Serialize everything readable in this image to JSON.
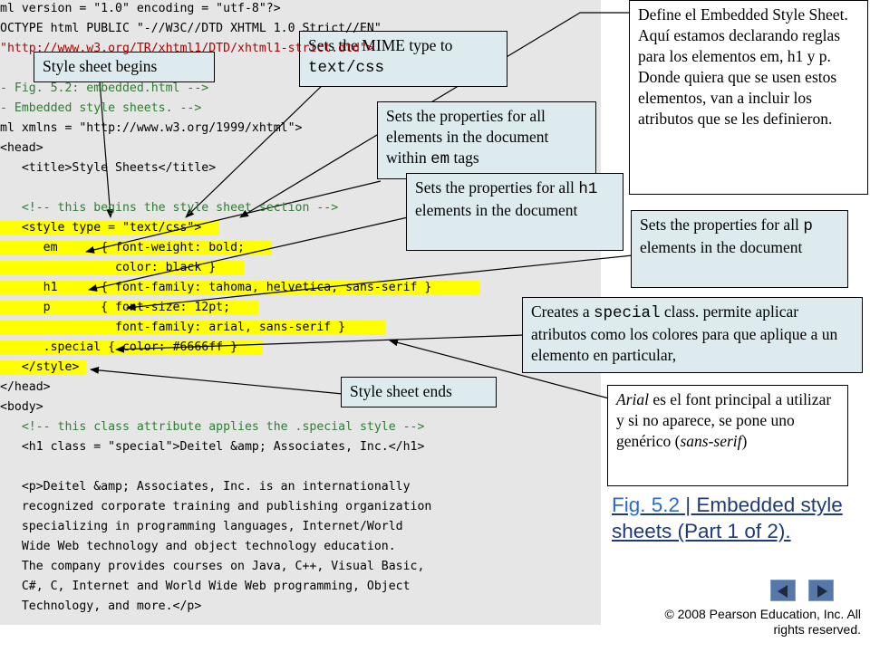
{
  "code": {
    "l0": "ml version = \"1.0\" encoding = \"utf-8\"?>",
    "l1": "OCTYPE html PUBLIC \"-//W3C//DTD XHTML 1.0 Strict//EN\"",
    "l2": "\"http://www.w3.org/TR/xhtml1/DTD/xhtml1-strict.dtd\">",
    "l3": "",
    "l4": "- Fig. 5.2: embedded.html -->",
    "l5": "- Embedded style sheets. -->",
    "l6": "ml xmlns = \"http://www.w3.org/1999/xhtml\">",
    "l7": "<head>",
    "l8": "   <title>Style Sheets</title>",
    "l9": "",
    "l10": "   <!-- this begins the style sheet section -->",
    "l11": "   <style type = \"text/css\">",
    "l12": "      em      { font-weight: bold;",
    "l13": "                color: black }",
    "l14": "      h1      { font-family: tahoma, helvetica, sans-serif }",
    "l15": "      p       { font-size: 12pt;",
    "l16": "                font-family: arial, sans-serif }",
    "l17": "      .special { color: #6666ff }",
    "l18": "   </style>",
    "l19": "</head>",
    "l20": "<body>",
    "l21": "   <!-- this class attribute applies the .special style -->",
    "l22": "   <h1 class = \"special\">Deitel &amp; Associates, Inc.</h1>",
    "l23": "",
    "l24": "   <p>Deitel &amp; Associates, Inc. is an internationally",
    "l25": "   recognized corporate training and publishing organization",
    "l26": "   specializing in programming languages, Internet/World",
    "l27": "   Wide Web technology and object technology education.",
    "l28": "   The company provides courses on Java, C++, Visual Basic,",
    "l29": "   C#, C, Internet and World Wide Web programming, Object",
    "l30": "   Technology, and more.</p>"
  },
  "callouts": {
    "style_begins": "Style sheet begins",
    "mime_pre": "Sets the MIME type to ",
    "mime_code": "text/css",
    "em_pre": "Sets the properties for all elements in the document within ",
    "em_code": "em",
    "em_post": " tags",
    "h1_pre": "Sets the properties for all ",
    "h1_code": "h1",
    "h1_post": " elements in the document",
    "p_pre": "Sets the properties for all ",
    "p_code": "p",
    "p_post": " elements in the document",
    "special_pre": "Creates a ",
    "special_code": "special",
    "special_post": " class. permite aplicar atributos como los colores para que aplique a un elemento en particular,",
    "define": "Define el Embedded Style Sheet.   Aquí estamos declarando reglas para los elementos em, h1 y p. Donde quiera que se usen estos elementos,  van a incluir los atributos que se les definieron.",
    "style_ends": "Style sheet ends",
    "arial_lead": "Arial",
    "arial_mid": " es el font principal a utilizar y si no aparece, se pone uno genérico (",
    "arial_sans": "sans-serif",
    "arial_end": ")"
  },
  "caption": {
    "fig_link": "Fig. 5.2",
    "fig_title": " | Embedded style sheets (Part 1 of 2)."
  },
  "footer": {
    "copyright": "© 2008 Pearson Education, Inc.  All rights reserved."
  },
  "colors": {
    "highlight": "#ffff00",
    "callout_bg": "#ddebee",
    "code_bg": "#e6e6e6",
    "link": "#2a6ad6"
  }
}
